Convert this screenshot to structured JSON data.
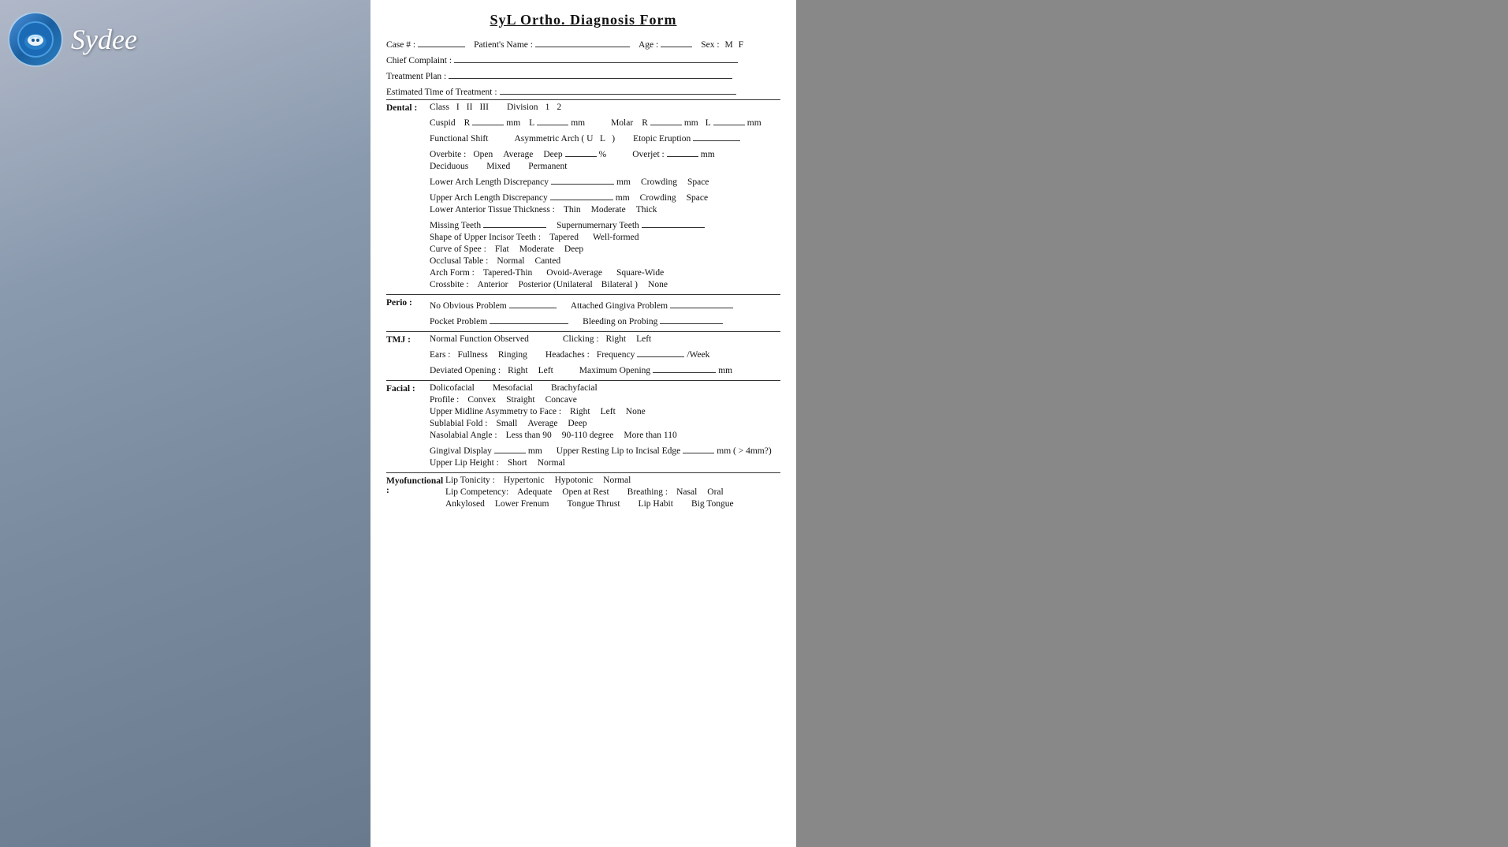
{
  "app": {
    "brand": "Sydee",
    "title": "SyL Ortho. Diagnosis Form"
  },
  "header": {
    "case_label": "Case # :",
    "patient_label": "Patient's Name :",
    "age_label": "Age :",
    "sex_label": "Sex :",
    "sex_m": "M",
    "sex_f": "F",
    "chief_label": "Chief Complaint :",
    "treatment_label": "Treatment Plan :",
    "estimated_label": "Estimated Time of Treatment :"
  },
  "dental": {
    "section": "Dental :",
    "class_label": "Class",
    "class_opts": [
      "I",
      "II",
      "III"
    ],
    "division_label": "Division",
    "div_opts": [
      "1",
      "2"
    ],
    "cuspid_label": "Cuspid",
    "r_label": "R",
    "mm_label": "mm",
    "l_label": "L",
    "molar_label": "Molar",
    "functional_shift_label": "Functional Shift",
    "asymmetric_arch_label": "Asymmetric Arch (",
    "u_label": "U",
    "l2_label": "L",
    "r_paren": ")",
    "etopic_label": "Etopic Eruption",
    "overbite_label": "Overbite :",
    "overbite_opts": [
      "Open",
      "Average",
      "Deep"
    ],
    "percent": "%",
    "overjet_label": "Overjet :",
    "deciduous_opts": [
      "Deciduous",
      "Mixed",
      "Permanent"
    ],
    "lower_arch_label": "Lower Arch Length Discrepancy",
    "upper_arch_label": "Upper Arch Length Discrepancy",
    "crowding": "Crowding",
    "space": "Space",
    "lower_anterior_label": "Lower Anterior Tissue Thickness :",
    "tissue_opts": [
      "Thin",
      "Moderate",
      "Thick"
    ],
    "missing_teeth_label": "Missing Teeth",
    "supernumerary_label": "Supernumernary Teeth",
    "shape_label": "Shape of Upper Incisor Teeth :",
    "shape_opts": [
      "Tapered",
      "Well-formed"
    ],
    "curve_label": "Curve of Spee :",
    "curve_opts": [
      "Flat",
      "Moderate",
      "Deep"
    ],
    "occlusal_label": "Occlusal Table :",
    "occlusal_opts": [
      "Normal",
      "Canted"
    ],
    "arch_form_label": "Arch Form :",
    "arch_opts": [
      "Tapered-Thin",
      "Ovoid-Average",
      "Square-Wide"
    ],
    "crossbite_label": "Crossbite :",
    "crossbite_opts": [
      "Anterior",
      "Posterior (Unilateral",
      "Bilateral )",
      "None"
    ]
  },
  "perio": {
    "section": "Perio :",
    "no_obvious_label": "No Obvious Problem",
    "attached_label": "Attached Gingiva Problem",
    "pocket_label": "Pocket Problem",
    "bleeding_label": "Bleeding on Probing"
  },
  "tmj": {
    "section": "TMJ :",
    "normal_label": "Normal Function Observed",
    "clicking_label": "Clicking :",
    "right": "Right",
    "left": "Left",
    "ears_label": "Ears :",
    "ears_opts": [
      "Fullness",
      "Ringing"
    ],
    "headaches_label": "Headaches :",
    "frequency_label": "Frequency",
    "week_label": "/Week",
    "deviated_label": "Deviated Opening :",
    "dev_opts": [
      "Right",
      "Left"
    ],
    "max_opening_label": "Maximum Opening",
    "mm_label": "mm"
  },
  "facial": {
    "section": "Facial :",
    "facial_opts": [
      "Dolicofacial",
      "Mesofacial",
      "Brachyfacial"
    ],
    "profile_label": "Profile :",
    "profile_opts": [
      "Convex",
      "Straight",
      "Concave"
    ],
    "upper_midline_label": "Upper Midline Asymmetry to Face :",
    "midline_opts": [
      "Right",
      "Left",
      "None"
    ],
    "sublabial_label": "Sublabial Fold :",
    "sublabial_opts": [
      "Small",
      "Average",
      "Deep"
    ],
    "nasolabial_label": "Nasolabial Angle :",
    "nasol_opts": [
      "Less than 90",
      "90-110 degree",
      "More than 110"
    ],
    "gingival_label": "Gingival Display",
    "mm_label": "mm",
    "upper_resting_label": "Upper Resting Lip to Incisal Edge",
    "mm2_label": "mm ( > 4mm?)",
    "upper_lip_label": "Upper Lip Height :",
    "lip_opts": [
      "Short",
      "Normal"
    ]
  },
  "myofunctional": {
    "section": "Myofunctional :",
    "lip_tonicity_label": "Lip Tonicity :",
    "lt_opts": [
      "Hypertonic",
      "Hypotonic",
      "Normal"
    ],
    "lip_competency_label": "Lip Competency:",
    "lc_opts": [
      "Adequate",
      "Open at Rest"
    ],
    "breathing_label": "Breathing :",
    "br_opts": [
      "Nasal",
      "Oral"
    ],
    "ankylosed_label": "Ankylosed",
    "lower_frenum_label": "Lower Frenum",
    "tongue_thrust_label": "Tongue Thrust",
    "lip_habit_label": "Lip Habit",
    "big_tongue_label": "Big Tongue"
  }
}
